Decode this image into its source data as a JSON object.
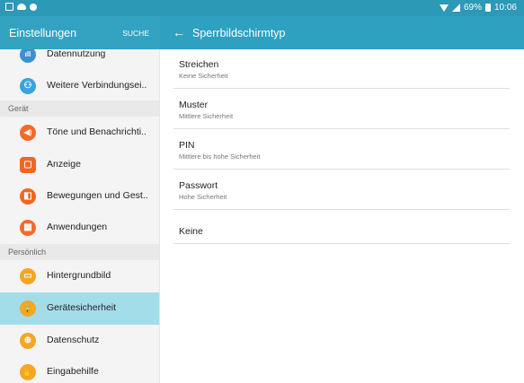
{
  "status_bar": {
    "left_icons": [
      "gallery-icon",
      "cloud-icon",
      "download-icon"
    ],
    "battery": "69%",
    "time": "10:06"
  },
  "left_header": {
    "title": "Einstellungen",
    "search": "SUCHE"
  },
  "right_header": {
    "back_icon": "←",
    "title": "Sperrbildschirmtyp"
  },
  "sidebar": {
    "items": [
      {
        "label": "Datennutzung",
        "icon": "data-usage-icon",
        "color": "#3d8fd1",
        "glyph": "ıll"
      },
      {
        "label": "Weitere Verbindungsei..",
        "icon": "more-connections-icon",
        "color": "#3aa3e0",
        "glyph": "⚇"
      },
      {
        "header": "Gerät"
      },
      {
        "label": "Töne und Benachrichti..",
        "icon": "sound-icon",
        "color": "#f36b2a",
        "glyph": "◀)"
      },
      {
        "label": "Anzeige",
        "icon": "display-icon",
        "color": "#f26522",
        "glyph": "▢"
      },
      {
        "label": "Bewegungen und Gest..",
        "icon": "motion-icon",
        "color": "#f26522",
        "glyph": "◧"
      },
      {
        "label": "Anwendungen",
        "icon": "apps-icon",
        "color": "#f36b2a",
        "glyph": "▦"
      },
      {
        "header": "Persönlich"
      },
      {
        "label": "Hintergrundbild",
        "icon": "wallpaper-icon",
        "color": "#f5a623",
        "glyph": "▭"
      },
      {
        "label": "Gerätesicherheit",
        "icon": "lock-icon",
        "color": "#f5a623",
        "glyph": "🔒",
        "selected": true
      },
      {
        "label": "Datenschutz",
        "icon": "privacy-icon",
        "color": "#f5a623",
        "glyph": "⊕"
      },
      {
        "label": "Eingabehilfe",
        "icon": "accessibility-icon",
        "color": "#f5a623",
        "glyph": "✋"
      }
    ]
  },
  "options": [
    {
      "title": "Streichen",
      "subtitle": "Keine Sicherheit"
    },
    {
      "title": "Muster",
      "subtitle": "Mittlere Sicherheit"
    },
    {
      "title": "PIN",
      "subtitle": "Mittlere bis hohe Sicherheit"
    },
    {
      "title": "Passwort",
      "subtitle": "Hohe Sicherheit"
    },
    {
      "title": "Keine",
      "subtitle": ""
    }
  ]
}
